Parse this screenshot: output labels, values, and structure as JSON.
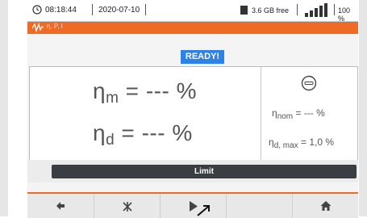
{
  "status": {
    "time": "08:18:44",
    "date": "2020-07-10",
    "free_space": "3.6 GB free",
    "battery_level": "100 %"
  },
  "mode": {
    "label": "η, P, I",
    "icon": "waveform-icon"
  },
  "ready_badge": "READY!",
  "measurements": {
    "eta_m": {
      "symbol": "η",
      "subscript": "m",
      "value": " = --- %"
    },
    "eta_d": {
      "symbol": "η",
      "subscript": "d",
      "value": " = --- %"
    },
    "eta_nom": {
      "symbol": "η",
      "subscript": "nom",
      "value": " = --- %"
    },
    "eta_d_max": {
      "symbol": "η",
      "subscript": "d, max",
      "value": " = 1,0 %"
    }
  },
  "limit_button": "Limit",
  "toolbar": {
    "buttons": [
      {
        "name": "back",
        "icon": "back-arrow-icon"
      },
      {
        "name": "settings",
        "icon": "tools-icon"
      },
      {
        "name": "start",
        "icon": "play-icon"
      },
      {
        "name": "empty",
        "icon": ""
      },
      {
        "name": "home",
        "icon": "home-icon"
      }
    ]
  },
  "colors": {
    "accent": "#ee6a25",
    "ready": "#2c82e6",
    "limit_bg": "#3a3e42"
  }
}
